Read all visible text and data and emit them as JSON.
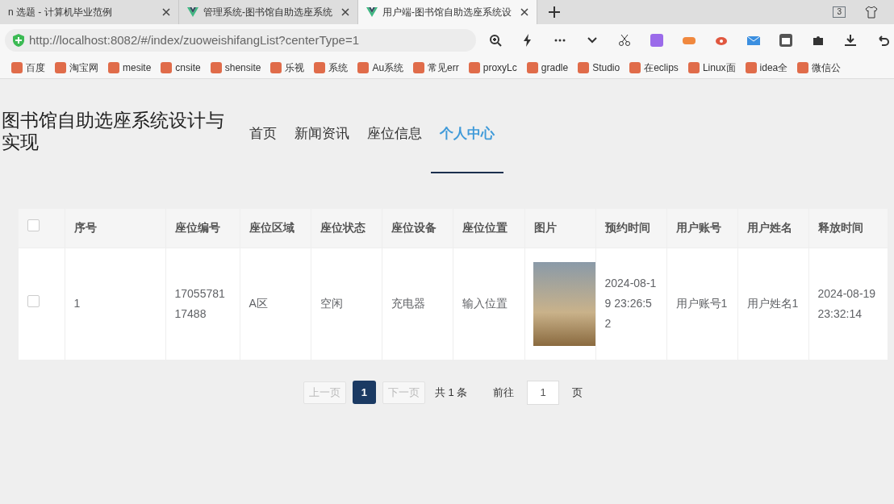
{
  "browser": {
    "tabs": [
      {
        "title": "n 选题 - 计算机毕业范例",
        "selected": false,
        "kind": "plain"
      },
      {
        "title": "管理系统-图书馆自助选座系统",
        "selected": false,
        "kind": "vue"
      },
      {
        "title": "用户端-图书馆自助选座系统设",
        "selected": true,
        "kind": "vue"
      }
    ],
    "tab_count": "3",
    "url": "http://localhost:8082/#/index/zuoweishifangList?centerType=1",
    "bookmarks": [
      "百度",
      "淘宝网",
      "mesite",
      "cnsite",
      "shensite",
      "乐视",
      "系统",
      "Au系统",
      "常见err",
      "proxyLc",
      "gradle",
      "Studio",
      "在eclips",
      "Linux面",
      "idea全",
      "微信公"
    ]
  },
  "site": {
    "title": "图书馆自助选座系统设计与实现",
    "nav": [
      {
        "label": "首页",
        "selected": false
      },
      {
        "label": "新闻资讯",
        "selected": false
      },
      {
        "label": "座位信息",
        "selected": false
      },
      {
        "label": "个人中心",
        "selected": true
      }
    ]
  },
  "table": {
    "columns": [
      "序号",
      "座位编号",
      "座位区域",
      "座位状态",
      "座位设备",
      "座位位置",
      "图片",
      "预约时间",
      "用户账号",
      "用户姓名",
      "释放时间"
    ],
    "header_checked": false,
    "rows": [
      {
        "checked": false,
        "cells": [
          "1",
          "1705578117488",
          "A区",
          "空闲",
          "充电器",
          "输入位置",
          null,
          "2024-08-19 23:26:52",
          "用户账号1",
          "用户姓名1",
          "2024-08-19 23:32:14"
        ]
      }
    ]
  },
  "pagination": {
    "prev": "上一页",
    "pages": [
      {
        "label": "1",
        "selected": true
      }
    ],
    "next": "下一页",
    "prev_disabled": true,
    "next_disabled": true,
    "total": "共 1 条",
    "goto": "前往",
    "goto_value": "1",
    "page_unit": "页"
  }
}
